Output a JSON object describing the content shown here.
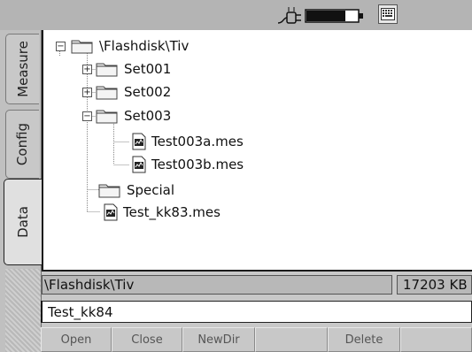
{
  "status_bar": {
    "icons": [
      "plug-icon",
      "battery-icon",
      "keyboard-icon"
    ],
    "battery_level": 0.75
  },
  "tabs": [
    {
      "label": "Measure",
      "active": false
    },
    {
      "label": "Config",
      "active": false
    },
    {
      "label": "Data",
      "active": true
    }
  ],
  "tree": {
    "root": {
      "label": "\\Flashdisk\\Tiv",
      "expander": "−"
    },
    "items": [
      {
        "label": "Set001",
        "type": "folder",
        "expander": "+"
      },
      {
        "label": "Set002",
        "type": "folder",
        "expander": "+"
      },
      {
        "label": "Set003",
        "type": "folder",
        "expander": "−"
      },
      {
        "label": "Test003a.mes",
        "type": "file"
      },
      {
        "label": "Test003b.mes",
        "type": "file"
      },
      {
        "label": "Special",
        "type": "folder"
      },
      {
        "label": "Test_kk83.mes",
        "type": "file"
      }
    ]
  },
  "path": {
    "current": "\\Flashdisk\\Tiv",
    "free_space": "17203 KB"
  },
  "filename_input": {
    "value": "Test_kk84"
  },
  "buttons": {
    "open": "Open",
    "close": "Close",
    "newdir": "NewDir",
    "delete": "Delete"
  }
}
